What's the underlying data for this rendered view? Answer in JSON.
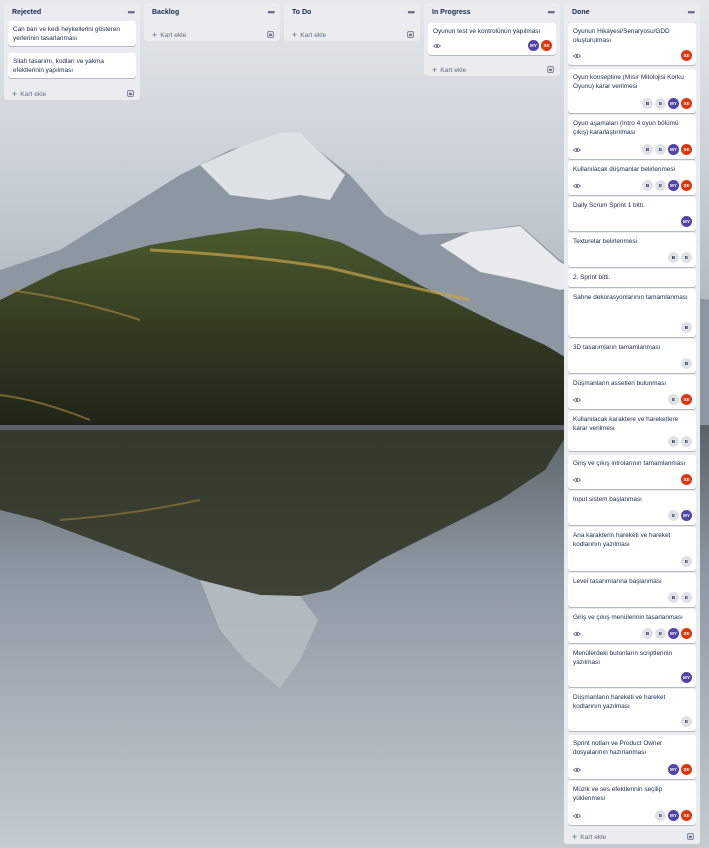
{
  "lists": [
    {
      "title": "Rejected",
      "add_label": "Kart ekle",
      "cards": [
        {
          "title": "Can barı ve kedi heykellerini gösteren yerlerinin tasarlanması",
          "watch": false,
          "members": []
        },
        {
          "title": "Silah tasarımı, kodları ve yakma efektlerinin yapılması",
          "watch": false,
          "members": []
        }
      ]
    },
    {
      "title": "Backlog",
      "add_label": "Kart ekle",
      "cards": []
    },
    {
      "title": "To Do",
      "add_label": "Kart ekle",
      "cards": []
    },
    {
      "title": "In Progress",
      "add_label": "Kart ekle",
      "cards": [
        {
          "title": "Oyunun test ve kontrolünün yapılması",
          "watch": true,
          "members": [
            "MY",
            "SE"
          ]
        }
      ]
    },
    {
      "title": "Done",
      "add_label": "Kart ekle",
      "cards": [
        {
          "title": "Oyunun Hikayesi/Senaryosu/GDD oluşturulması",
          "watch": true,
          "members": [
            "SE"
          ]
        },
        {
          "title": "Oyun konseptine (Mısır Mitolojisi Korku Oyunu) karar verilmesi",
          "watch": false,
          "members": [
            "B",
            "E",
            "MY",
            "SE"
          ]
        },
        {
          "title": "Oyun aşamaları (Intro 4 oyun bölümü çıkış) kararlaştırılması",
          "watch": true,
          "members": [
            "B",
            "E",
            "MY",
            "SE"
          ]
        },
        {
          "title": "Kullanılacak düşmanlar belirlenmesi",
          "watch": true,
          "members": [
            "B",
            "E",
            "MY",
            "SE"
          ]
        },
        {
          "title": "Daily Scrum Sprint 1 bitti.",
          "watch": false,
          "members": [
            "MY"
          ]
        },
        {
          "title": "Texturelar belirlenmesi",
          "watch": false,
          "members": [
            "B",
            "E"
          ]
        },
        {
          "title": "2. Sprint bitti.",
          "watch": false,
          "members": []
        },
        {
          "title": "Sahne dekorasyonlarının tamamlanması",
          "watch": false,
          "members": [
            "B"
          ]
        },
        {
          "title": "3D tasarımların tamamlanması",
          "watch": false,
          "members": [
            "B"
          ]
        },
        {
          "title": "Düşmanların assetleri bulunması",
          "watch": true,
          "members": [
            "E",
            "SE"
          ]
        },
        {
          "title": "Kullanılacak karaktere ve hareketlere karar verilmesi",
          "watch": false,
          "members": [
            "B",
            "E"
          ]
        },
        {
          "title": "Giriş ve çıkış introlarının tamamlanması",
          "watch": true,
          "members": [
            "SE"
          ]
        },
        {
          "title": "Input sistem başlanması",
          "watch": false,
          "members": [
            "E",
            "MY"
          ]
        },
        {
          "title": "Ana karakterin hareketi ve hareket kodlarının yazılması",
          "watch": false,
          "members": [
            "E"
          ]
        },
        {
          "title": "Level tasarımlarına başlanması",
          "watch": false,
          "members": [
            "B",
            "E"
          ]
        },
        {
          "title": "Giriş ve çıkış menülerinin tasarlanması",
          "watch": true,
          "members": [
            "B",
            "E",
            "MY",
            "SE"
          ]
        },
        {
          "title": "Menülerdeki butonların scriptlerinin yazılması",
          "watch": false,
          "members": [
            "MY"
          ]
        },
        {
          "title": "Düşmanların hareketi ve hareket kodlarının yazılması",
          "watch": false,
          "members": [
            "E"
          ]
        },
        {
          "title": "Sprint notları ve Product Owner dosyalarının hazırlanması",
          "watch": true,
          "members": [
            "MY",
            "SE"
          ]
        },
        {
          "title": "Müzik ve ses efektlerinin seçilip yüklenmesi",
          "watch": true,
          "members": [
            "E",
            "MY",
            "SE"
          ]
        }
      ]
    }
  ]
}
